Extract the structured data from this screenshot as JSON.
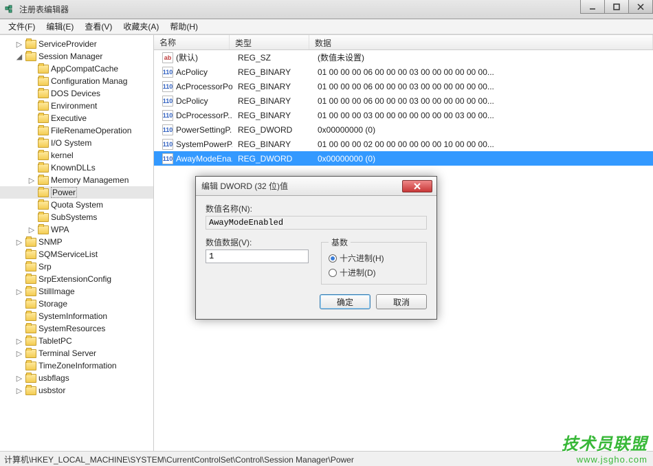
{
  "window": {
    "title": "注册表编辑器",
    "min_icon": "minimize-icon",
    "max_icon": "maximize-icon",
    "close_icon": "close-icon"
  },
  "menu": [
    "文件(F)",
    "编辑(E)",
    "查看(V)",
    "收藏夹(A)",
    "帮助(H)"
  ],
  "tree": [
    {
      "depth": 0,
      "toggle": "▷",
      "label": "ServiceProvider"
    },
    {
      "depth": 0,
      "toggle": "◢",
      "label": "Session Manager"
    },
    {
      "depth": 1,
      "toggle": "",
      "label": "AppCompatCache"
    },
    {
      "depth": 1,
      "toggle": "",
      "label": "Configuration Manag"
    },
    {
      "depth": 1,
      "toggle": "",
      "label": "DOS Devices"
    },
    {
      "depth": 1,
      "toggle": "",
      "label": "Environment"
    },
    {
      "depth": 1,
      "toggle": "",
      "label": "Executive"
    },
    {
      "depth": 1,
      "toggle": "",
      "label": "FileRenameOperation"
    },
    {
      "depth": 1,
      "toggle": "",
      "label": "I/O System"
    },
    {
      "depth": 1,
      "toggle": "",
      "label": "kernel"
    },
    {
      "depth": 1,
      "toggle": "",
      "label": "KnownDLLs"
    },
    {
      "depth": 1,
      "toggle": "▷",
      "label": "Memory Managemen"
    },
    {
      "depth": 1,
      "toggle": "",
      "label": "Power",
      "selected": true
    },
    {
      "depth": 1,
      "toggle": "",
      "label": "Quota System"
    },
    {
      "depth": 1,
      "toggle": "",
      "label": "SubSystems"
    },
    {
      "depth": 1,
      "toggle": "▷",
      "label": "WPA"
    },
    {
      "depth": 0,
      "toggle": "▷",
      "label": "SNMP"
    },
    {
      "depth": 0,
      "toggle": "",
      "label": "SQMServiceList"
    },
    {
      "depth": 0,
      "toggle": "",
      "label": "Srp"
    },
    {
      "depth": 0,
      "toggle": "",
      "label": "SrpExtensionConfig"
    },
    {
      "depth": 0,
      "toggle": "▷",
      "label": "StillImage"
    },
    {
      "depth": 0,
      "toggle": "",
      "label": "Storage"
    },
    {
      "depth": 0,
      "toggle": "",
      "label": "SystemInformation"
    },
    {
      "depth": 0,
      "toggle": "",
      "label": "SystemResources"
    },
    {
      "depth": 0,
      "toggle": "▷",
      "label": "TabletPC"
    },
    {
      "depth": 0,
      "toggle": "▷",
      "label": "Terminal Server"
    },
    {
      "depth": 0,
      "toggle": "",
      "label": "TimeZoneInformation"
    },
    {
      "depth": 0,
      "toggle": "▷",
      "label": "usbflags"
    },
    {
      "depth": 0,
      "toggle": "▷",
      "label": "usbstor"
    }
  ],
  "list": {
    "headers": {
      "name": "名称",
      "type": "类型",
      "data": "数据"
    },
    "rows": [
      {
        "icon": "sz",
        "name": "(默认)",
        "type": "REG_SZ",
        "data": "(数值未设置)"
      },
      {
        "icon": "bin",
        "name": "AcPolicy",
        "type": "REG_BINARY",
        "data": "01 00 00 00 06 00 00 00 03 00 00 00 00 00 00..."
      },
      {
        "icon": "bin",
        "name": "AcProcessorPo...",
        "type": "REG_BINARY",
        "data": "01 00 00 00 06 00 00 00 03 00 00 00 00 00 00..."
      },
      {
        "icon": "bin",
        "name": "DcPolicy",
        "type": "REG_BINARY",
        "data": "01 00 00 00 06 00 00 00 03 00 00 00 00 00 00..."
      },
      {
        "icon": "bin",
        "name": "DcProcessorP...",
        "type": "REG_BINARY",
        "data": "01 00 00 00 03 00 00 00 00 00 00 00 03 00 00..."
      },
      {
        "icon": "bin",
        "name": "PowerSettingP...",
        "type": "REG_DWORD",
        "data": "0x00000000 (0)"
      },
      {
        "icon": "bin",
        "name": "SystemPowerP...",
        "type": "REG_BINARY",
        "data": "01 00 00 00 02 00 00 00 00 00 00 10 00 00 00..."
      },
      {
        "icon": "bin",
        "name": "AwayModeEna...",
        "type": "REG_DWORD",
        "data": "0x00000000 (0)",
        "selected": true
      }
    ]
  },
  "statusbar": "计算机\\HKEY_LOCAL_MACHINE\\SYSTEM\\CurrentControlSet\\Control\\Session Manager\\Power",
  "dialog": {
    "title": "编辑 DWORD (32 位)值",
    "name_label": "数值名称(N):",
    "name_value": "AwayModeEnabled",
    "data_label": "数值数据(V):",
    "data_value": "1",
    "base_label": "基数",
    "radio_hex": "十六进制(H)",
    "radio_dec": "十进制(D)",
    "radio_selected": "hex",
    "ok": "确定",
    "cancel": "取消"
  },
  "watermark": {
    "line1": "技术员联盟",
    "line2": "www.jsgho.com"
  }
}
